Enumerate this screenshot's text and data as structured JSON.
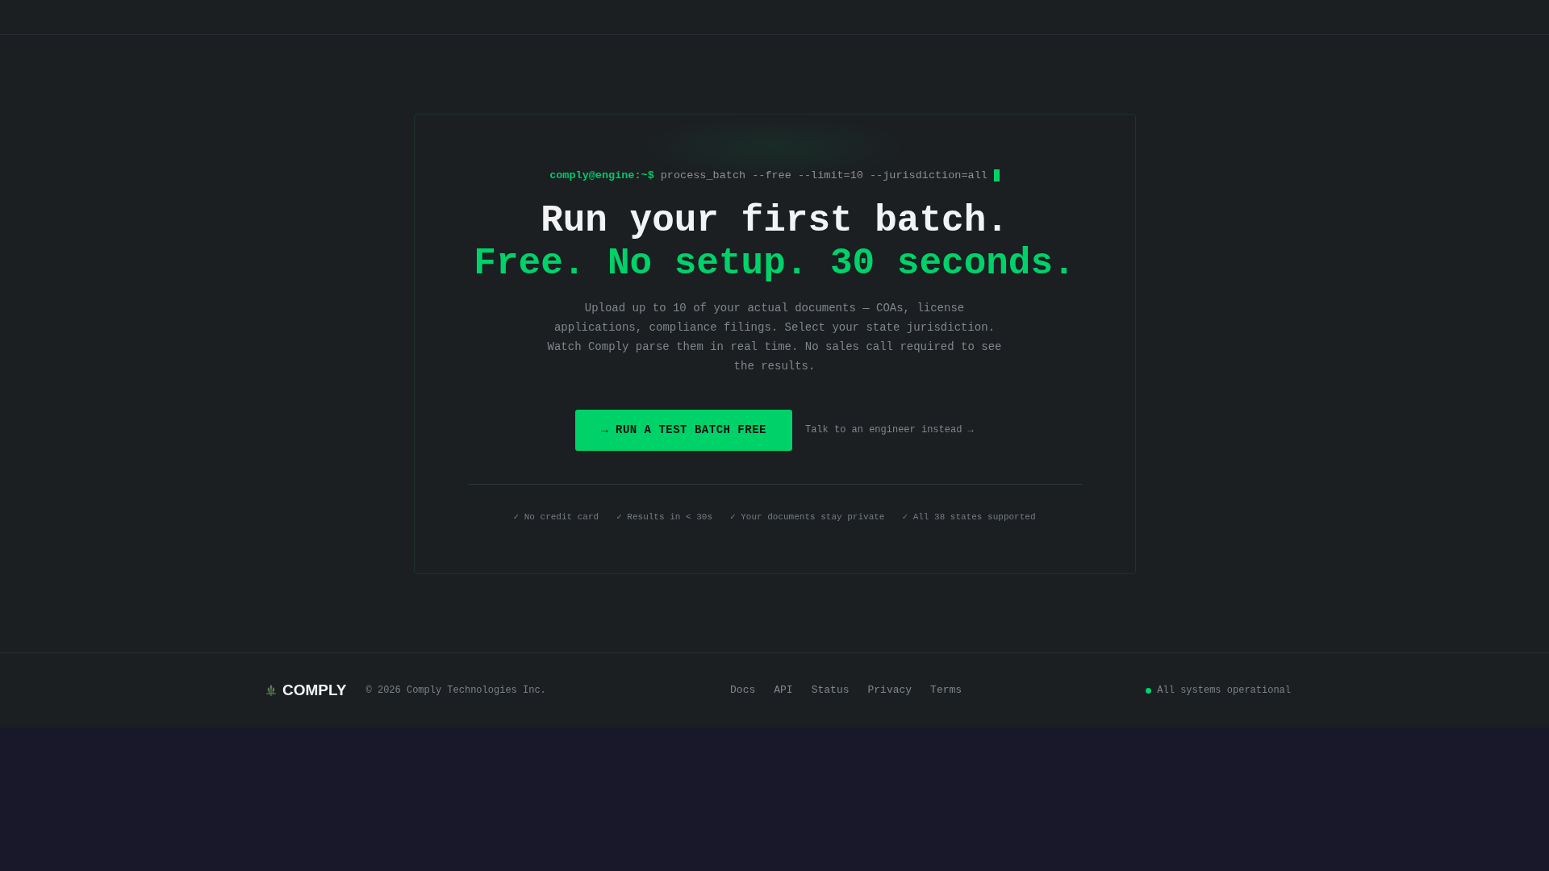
{
  "terminal": {
    "prompt": "comply@engine:~$",
    "command": "process_batch --free --limit=10 --jurisdiction=all"
  },
  "headline": {
    "line_1": "Run your first batch.",
    "line_2": "Free. No setup. 30 seconds."
  },
  "description": "Upload up to 10 of your actual documents — COAs, license applications, compliance filings. Select your state jurisdiction. Watch Comply parse them in real time. No sales call required to see the results.",
  "primary_button": "→ RUN A TEST BATCH FREE",
  "secondary_link": "Talk to an engineer instead →",
  "benefits": [
    "✓ No credit card",
    "✓ Results in < 30s",
    "✓ Your documents stay private",
    "✓ All 38 states supported"
  ],
  "footer": {
    "brand": "COMPLY",
    "copyright": "© 2026 Comply Technologies Inc.",
    "links": [
      "Docs",
      "API",
      "Status",
      "Privacy",
      "Terms"
    ],
    "status": "All systems operational"
  }
}
